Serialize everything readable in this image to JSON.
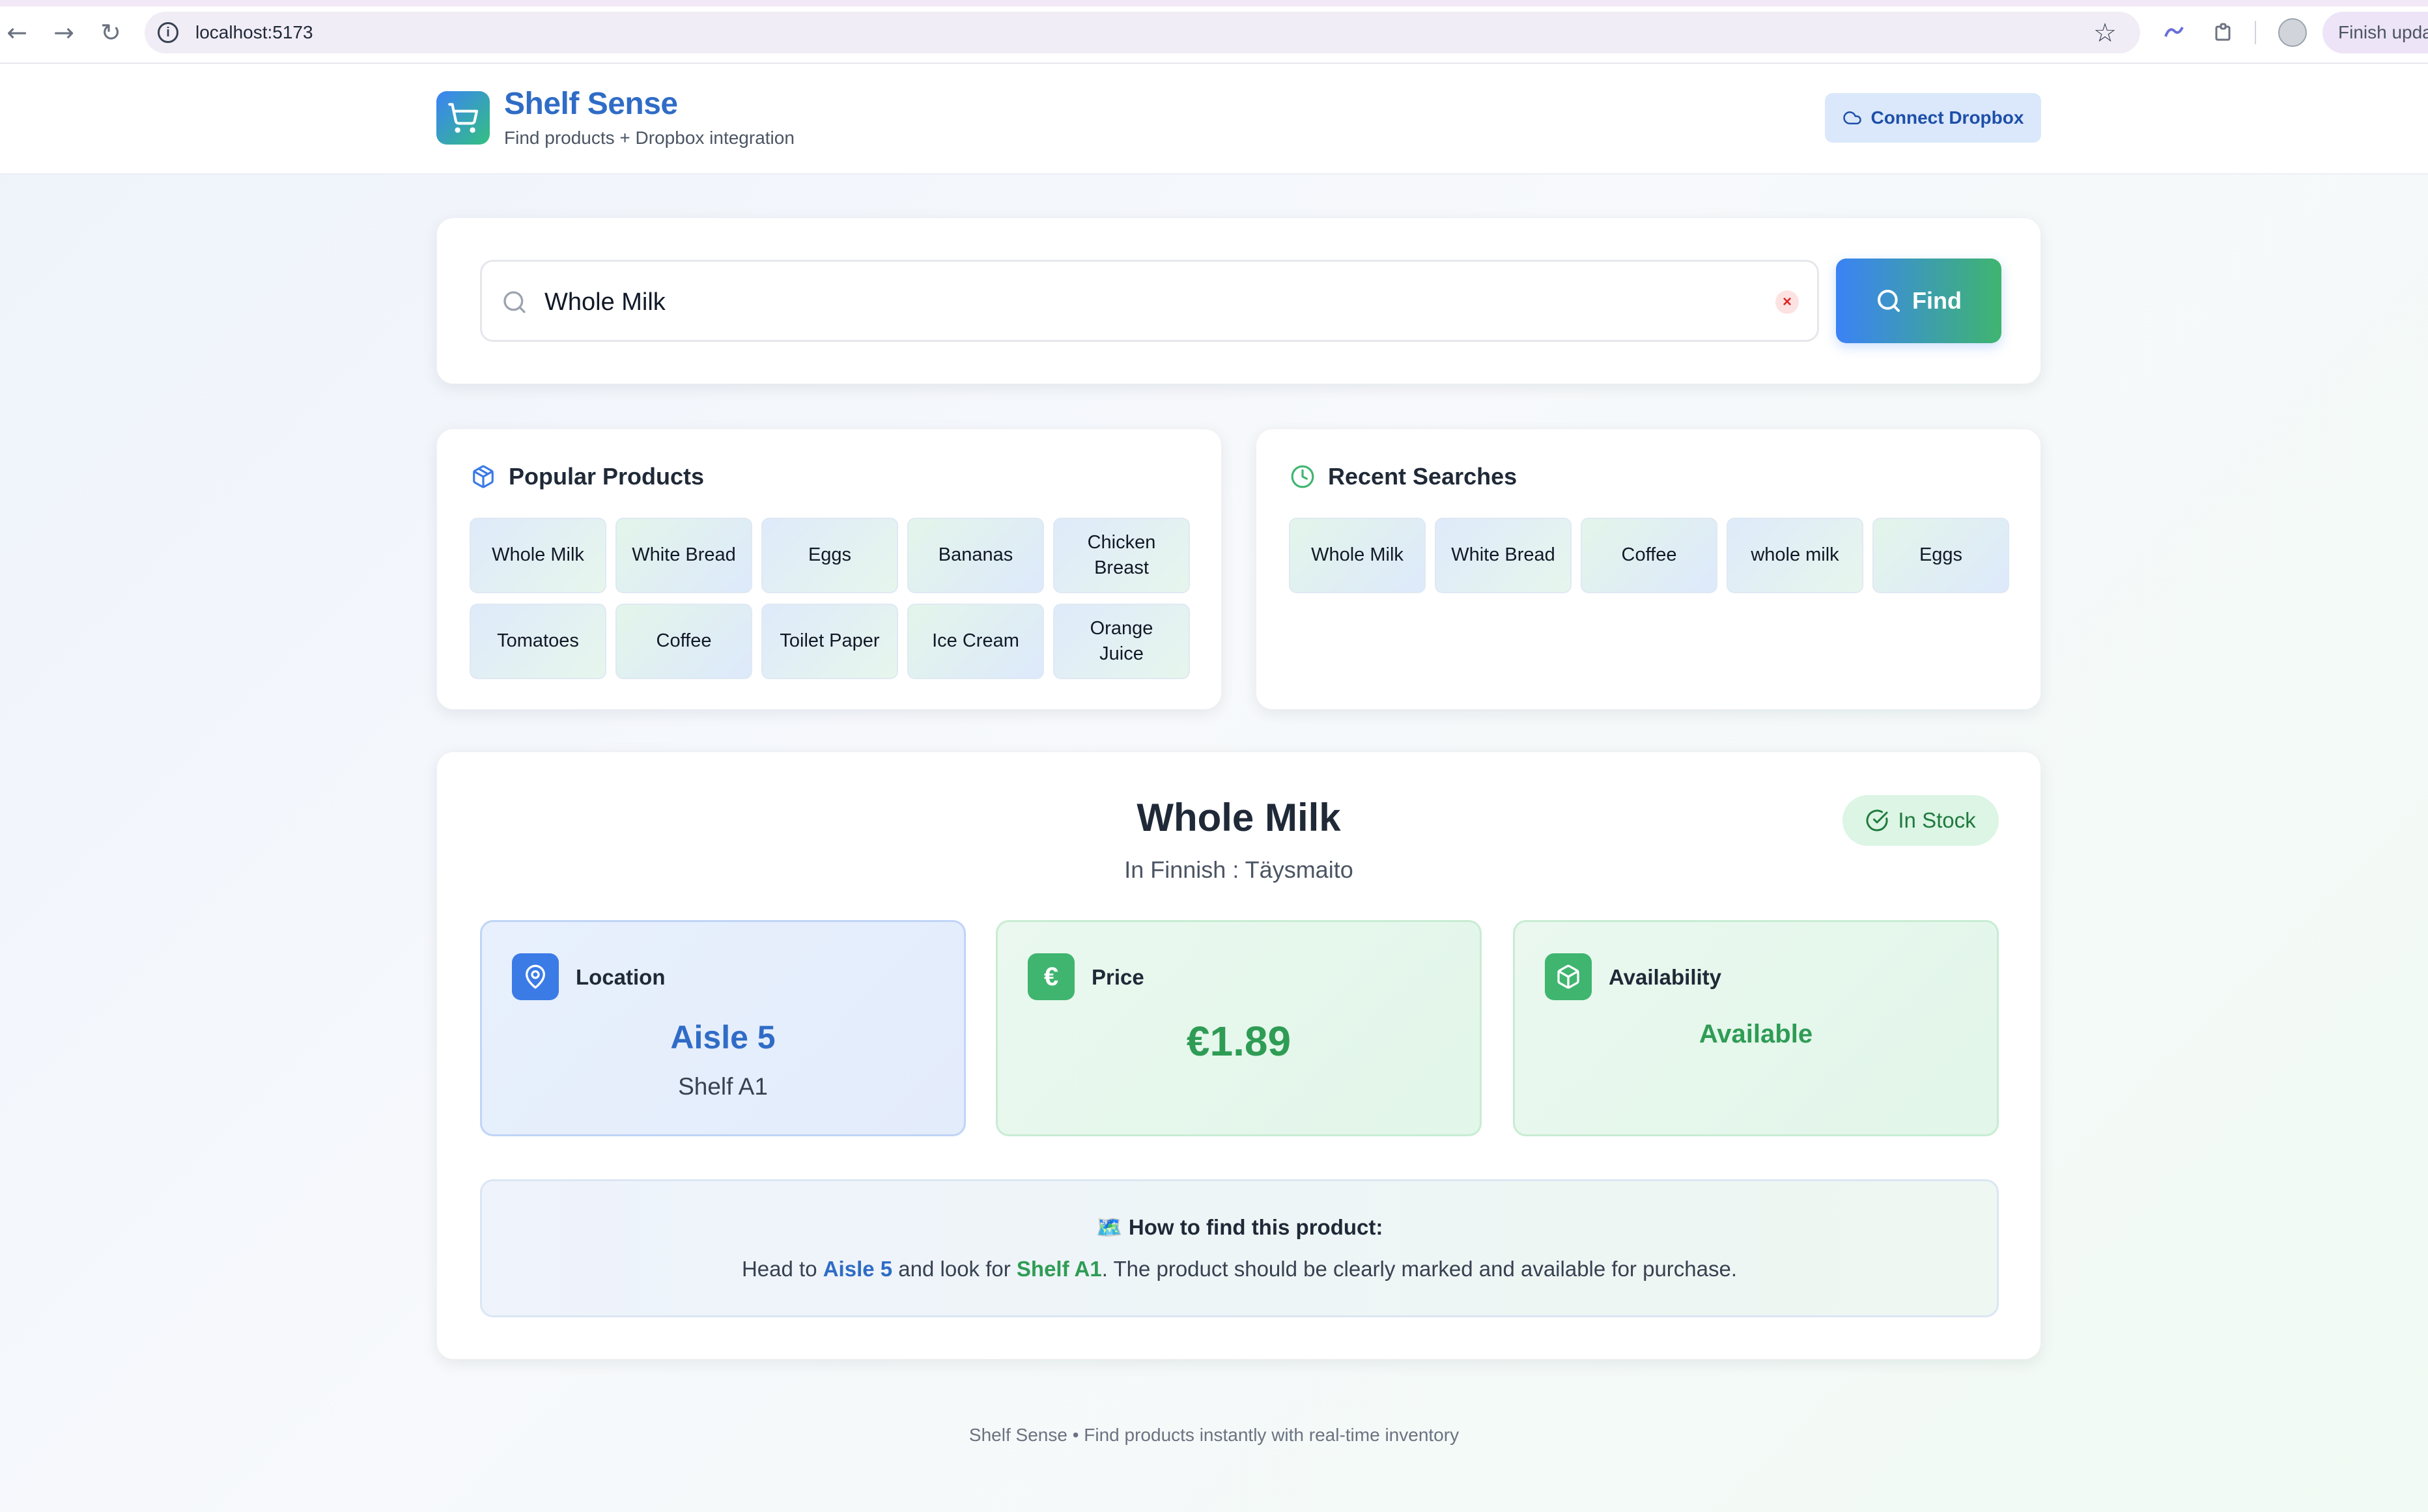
{
  "browser": {
    "url": "localhost:5173",
    "profile_button": "Finish upda"
  },
  "header": {
    "title": "Shelf Sense",
    "subtitle": "Find products + Dropbox integration",
    "connect_button": "Connect Dropbox"
  },
  "search": {
    "value": "Whole Milk",
    "clear_symbol": "×",
    "button_label": "Find"
  },
  "popular": {
    "title": "Popular Products",
    "items": [
      "Whole Milk",
      "White Bread",
      "Eggs",
      "Bananas",
      "Chicken Breast",
      "Tomatoes",
      "Coffee",
      "Toilet Paper",
      "Ice Cream",
      "Orange Juice"
    ]
  },
  "recent": {
    "title": "Recent Searches",
    "items": [
      "Whole Milk",
      "White Bread",
      "Coffee",
      "whole milk",
      "Eggs"
    ]
  },
  "result": {
    "product_name": "Whole Milk",
    "translation": "In Finnish : Täysmaito",
    "stock_status": "In Stock",
    "location": {
      "label": "Location",
      "aisle": "Aisle 5",
      "shelf": "Shelf A1"
    },
    "price": {
      "label": "Price",
      "value": "€1.89",
      "icon": "€"
    },
    "availability": {
      "label": "Availability",
      "value": "Available"
    },
    "howto": {
      "title": "🗺️ How to find this product:",
      "text_before": "Head to ",
      "aisle": "Aisle 5",
      "text_middle": " and look for ",
      "shelf": "Shelf A1",
      "text_after": ". The product should be clearly marked and available for purchase."
    }
  },
  "footer": {
    "text": "Shelf Sense • Find products instantly with real-time inventory"
  },
  "colors": {
    "brand_blue": "#2f6cc6",
    "brand_green": "#3fb56f",
    "location_accent": "#3b7be6",
    "stock_badge_bg": "#dcf5e4"
  }
}
